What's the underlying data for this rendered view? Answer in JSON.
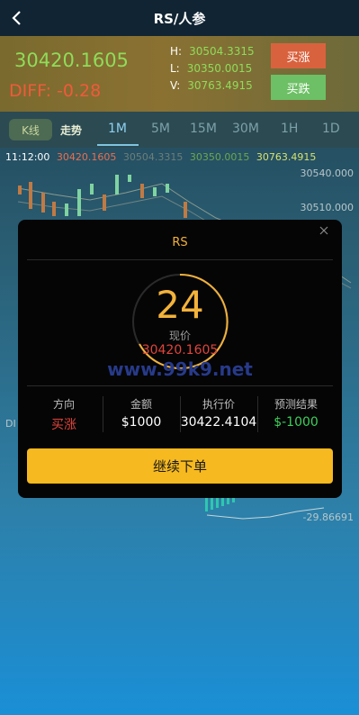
{
  "header": {
    "title": "RS/人参",
    "back_icon": "chevron-left-icon"
  },
  "quote": {
    "price": "30420.1605",
    "diff": "DIFF:  -0.28",
    "high_label": "H:",
    "high": "30504.3315",
    "low_label": "L:",
    "low": "30350.0015",
    "vol_label": "V:",
    "vol": "30763.4915",
    "buy_up_label": "买涨",
    "buy_down_label": "买跌"
  },
  "tabs": {
    "kline": "K线",
    "trend": "走势",
    "timeframes": [
      "1M",
      "5M",
      "15M",
      "30M",
      "1H",
      "1D"
    ],
    "active": "1M"
  },
  "chart": {
    "time": "11:12:00",
    "ma": [
      "30420.1605",
      "30504.3315",
      "30350.0015",
      "30763.4915"
    ],
    "y_labels": [
      "30540.000",
      "30510.000"
    ],
    "bottom_label": "-29.86691",
    "left_label": "DI"
  },
  "dialog": {
    "title": "RS",
    "countdown": "24",
    "now_label": "现价",
    "now_price": "30420.1605",
    "watermark": "www.99k9.net",
    "cols": [
      {
        "label": "方向",
        "value": "买涨"
      },
      {
        "label": "金额",
        "value": "$1000"
      },
      {
        "label": "执行价",
        "value": "30422.4104"
      },
      {
        "label": "预测结果",
        "value": "$-1000"
      }
    ],
    "confirm_label": "继续下单"
  },
  "colors": {
    "accent": "#f6b91f",
    "up": "#d9623e",
    "down": "#6dc065",
    "loss": "#3fcf5a",
    "danger": "#e0453a"
  }
}
